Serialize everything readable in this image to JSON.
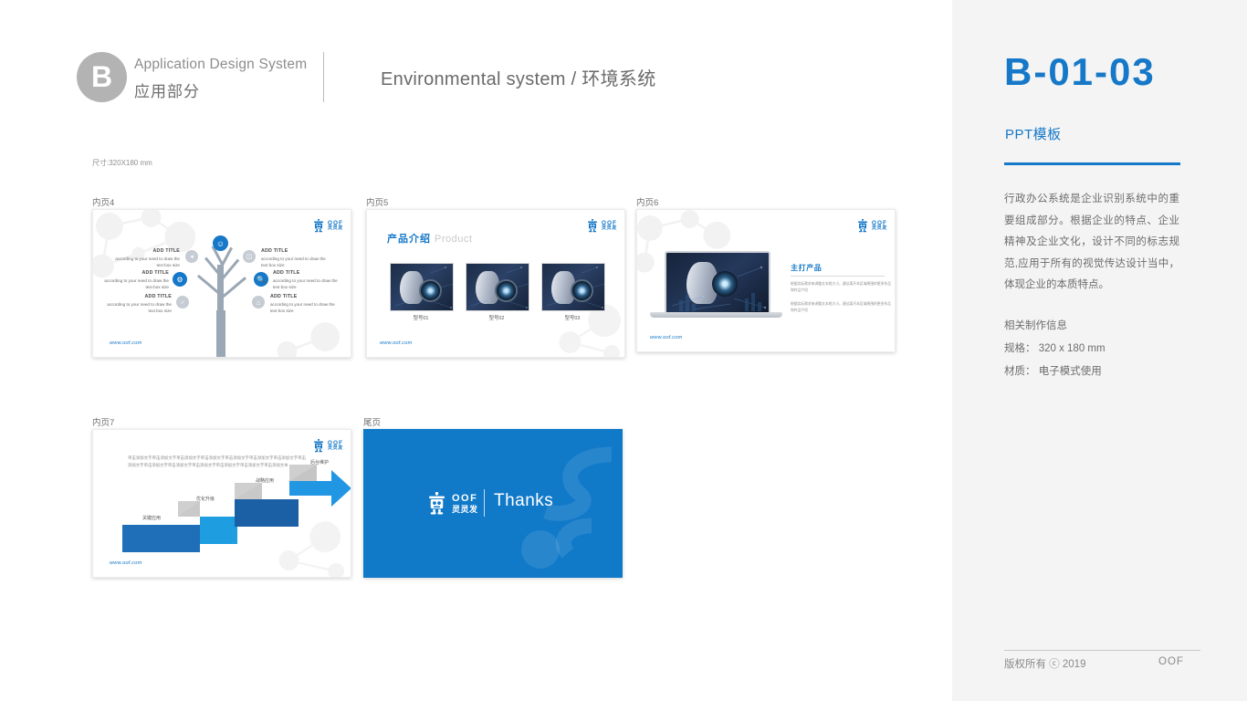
{
  "header": {
    "badge_letter": "B",
    "system_en": "Application Design System",
    "system_cn": "应用部分",
    "title": "Environmental system / 环境系统"
  },
  "right_panel": {
    "code": "B-01-03",
    "subtitle": "PPT模板",
    "description": "行政办公系统是企业识别系统中的重要组成部分。根据企业的特点、企业精神及企业文化，设计不同的标志规范,应用于所有的视觉传达设计当中，体现企业的本质特点。",
    "meta_heading": "相关制作信息",
    "meta_spec": "规格： 320 x 180  mm",
    "meta_material": "材质： 电子模式使用",
    "footer_copyright": "版权所有 ⓒ   2019",
    "footer_brand": "OOF",
    "accent_color": "#1578c8"
  },
  "size_note": "尺寸:320X180 mm",
  "brand": {
    "logo_en": "OOF",
    "logo_cn": "灵灵发",
    "website": "www.oof.com"
  },
  "slides": [
    {
      "caption": "内页4",
      "type": "tree-diagram",
      "nodes": [
        {
          "icon": "lightbulb-icon",
          "glyph": "☀",
          "color": "blue",
          "title": "",
          "body": ""
        },
        {
          "icon": "megaphone-icon",
          "glyph": "◀",
          "color": "grey",
          "title": "ADD TITLE",
          "body": "according to your need to draw the text box size"
        },
        {
          "icon": "bar-chart-icon",
          "glyph": "▐",
          "color": "grey",
          "title": "ADD TITLE",
          "body": "according to your need to draw the text box size"
        },
        {
          "icon": "gear-icon",
          "glyph": "⚙",
          "color": "blue",
          "title": "ADD TITLE",
          "body": "according to your need to draw the text box size"
        },
        {
          "icon": "search-icon",
          "glyph": "⚲",
          "color": "blue",
          "title": "ADD TITLE",
          "body": "according to your need to draw the text box size"
        },
        {
          "icon": "pin-icon",
          "glyph": "♀",
          "color": "grey",
          "title": "ADD TITLE",
          "body": "according to your need to draw the text box size"
        },
        {
          "icon": "home-icon",
          "glyph": "⌂",
          "color": "grey",
          "title": "ADD TITLE",
          "body": "according to your need to draw the text box size"
        }
      ]
    },
    {
      "caption": "内页5",
      "type": "product-gallery",
      "title_cn": "产品介绍",
      "title_en": "Product",
      "products": [
        {
          "label": "型号01"
        },
        {
          "label": "型号02"
        },
        {
          "label": "型号03"
        }
      ]
    },
    {
      "caption": "内页6",
      "type": "feature-product",
      "heading": "主打产品",
      "paragraphs": [
        "根据实际需求来调整文本框大小。建议离开本区域周围的更多作品和作品介绍",
        "根据实际需求来调整文本框大小。建议离开本区域周围的更多作品和作品介绍"
      ]
    },
    {
      "caption": "内页7",
      "type": "step-arrow",
      "body": "单击添加文字单击添加文字单击添加文字单击添加文字单击添加文字单击添加文字单击添加文字单击添加文字单击添加文字单击添加文字单击添加文字单击添加文字单击添加文字单击添加文本",
      "steps": [
        {
          "label": "关键应用"
        },
        {
          "label": "优化升级"
        },
        {
          "label": "战略应用"
        },
        {
          "label": "后台维护"
        }
      ]
    },
    {
      "caption": "尾页",
      "type": "end-page",
      "thanks": "Thanks",
      "background_color": "#1079c8"
    }
  ]
}
